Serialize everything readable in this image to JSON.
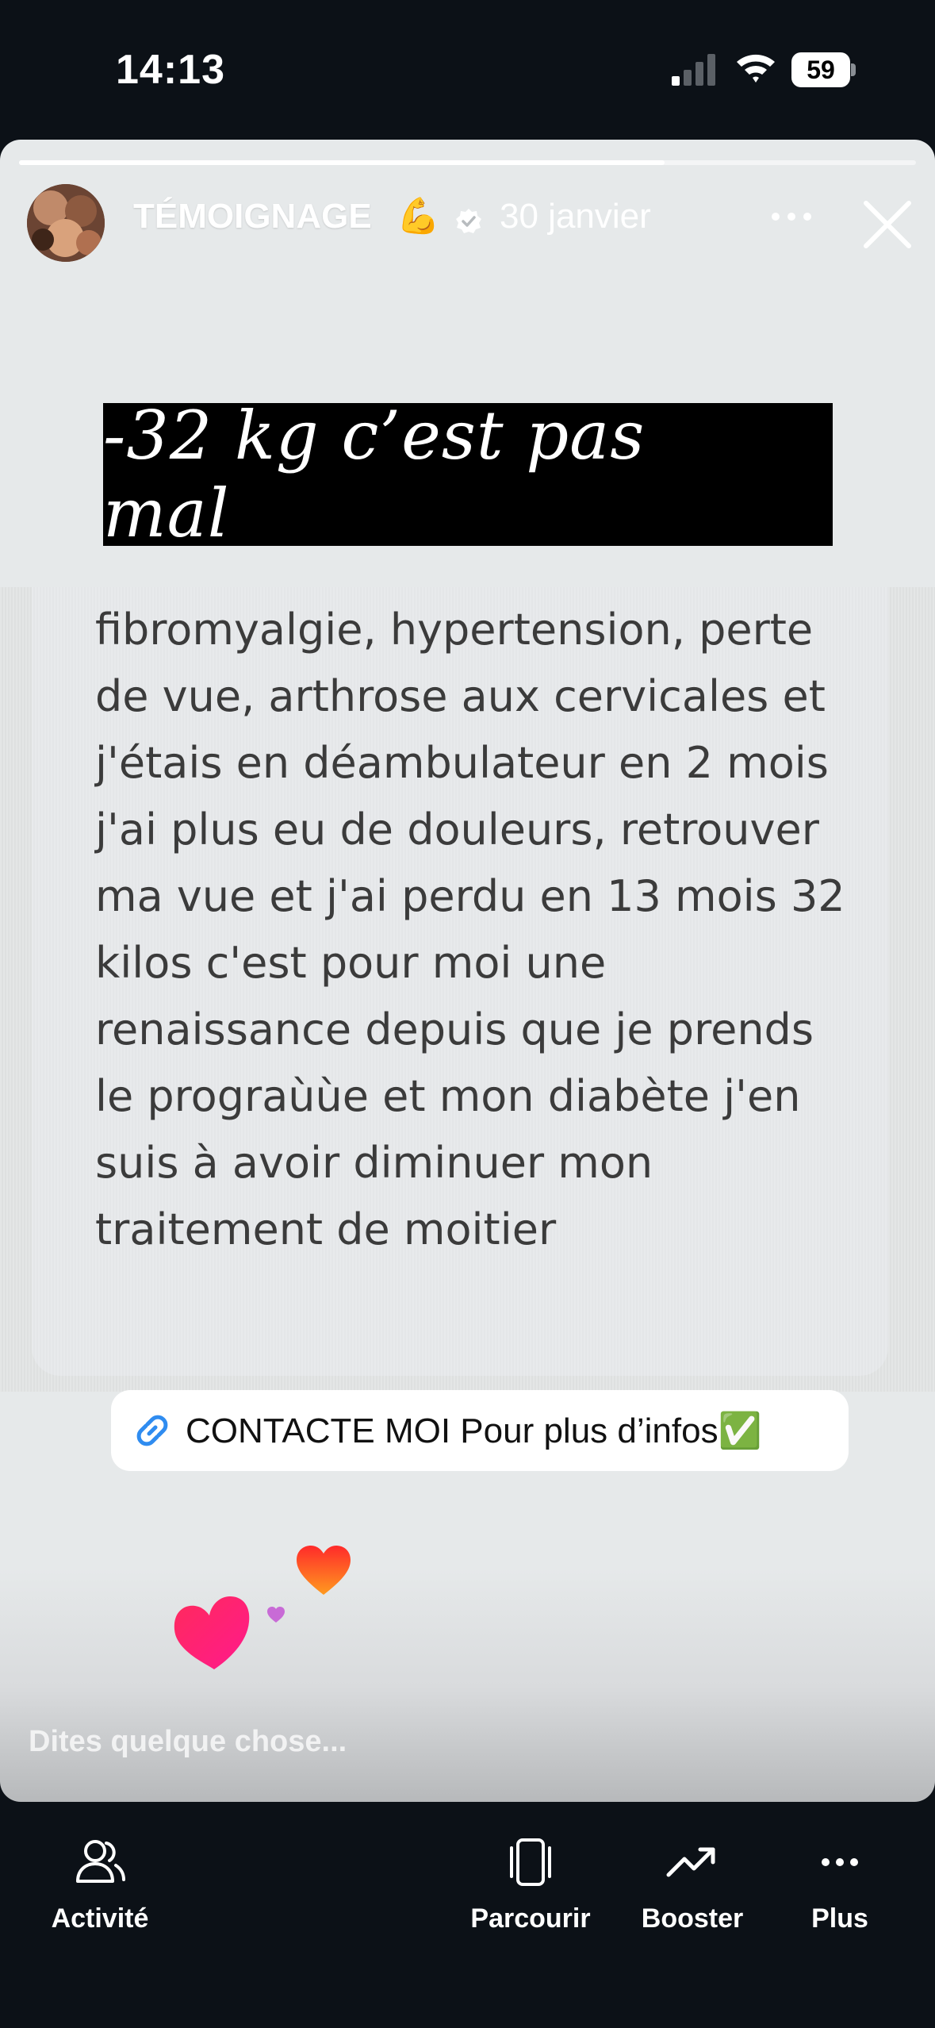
{
  "status_bar": {
    "time": "14:13",
    "battery": "59"
  },
  "story": {
    "username": "TÉMOIGNAGE",
    "username_emoji": "💪",
    "date": "30 janvier",
    "caption": "-32 kg c’est pas mal",
    "caption_emoji": "😎",
    "message_lines": [
      "fibromyalgie, hypertension, perte",
      "de vue, arthrose aux cervicales et",
      "j'étais en déambulateur en 2 mois",
      "j'ai plus eu de douleurs, retrouver",
      "ma vue et j'ai perdu en 13 mois 32",
      "kilos c'est pour moi une",
      "renaissance depuis que je prends",
      "le prograùùe et mon diabète j'en",
      "suis à avoir diminuer mon",
      "traitement de moitier"
    ],
    "link_sticker": "CONTACTE MOI Pour plus d’infos✅",
    "reply_placeholder": "Dites quelque chose...",
    "progress_fraction": 0.72,
    "icons": {
      "verified": "verified-badge-icon",
      "more": "more-horizontal-icon",
      "close": "close-icon",
      "link": "link-icon"
    }
  },
  "bottom_nav": {
    "activity": "Activité",
    "browse": "Parcourir",
    "boost": "Booster",
    "more": "Plus"
  },
  "colors": {
    "background": "#0c1117",
    "link_blue": "#2f8cf0",
    "heart_pink": "#ff1f6e",
    "heart_orange": "#ff6a1f"
  }
}
